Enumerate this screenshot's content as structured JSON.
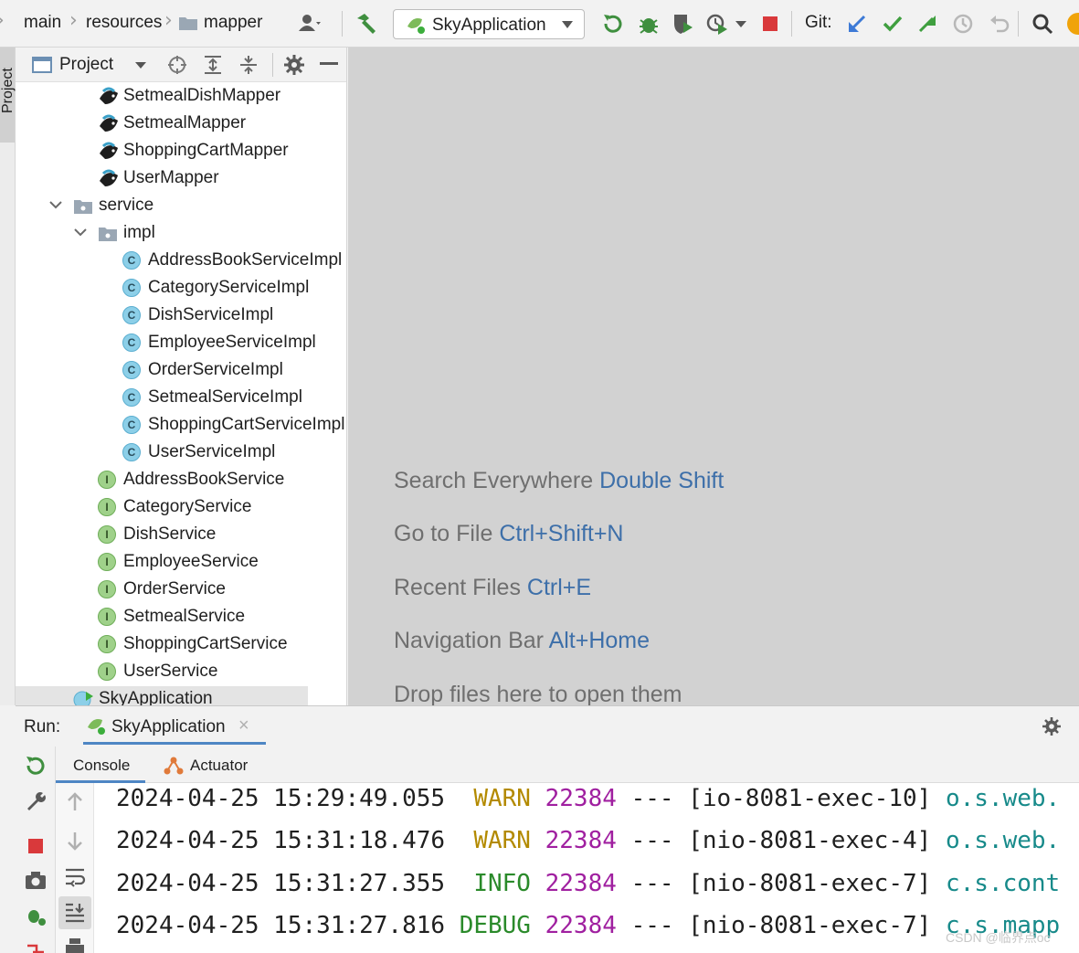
{
  "breadcrumb": {
    "items": [
      "main",
      "resources",
      "mapper"
    ]
  },
  "toolbar": {
    "run_config": "SkyApplication",
    "git_label": "Git:"
  },
  "project_panel": {
    "title": "Project",
    "tree": [
      {
        "label": "SetmealDishMapper",
        "kind": "mapper",
        "indent": 2
      },
      {
        "label": "SetmealMapper",
        "kind": "mapper",
        "indent": 2
      },
      {
        "label": "ShoppingCartMapper",
        "kind": "mapper",
        "indent": 2
      },
      {
        "label": "UserMapper",
        "kind": "mapper",
        "indent": 2
      },
      {
        "label": "service",
        "kind": "folder",
        "indent": 1,
        "expanded": true
      },
      {
        "label": "impl",
        "kind": "folder",
        "indent": 2,
        "expanded": true
      },
      {
        "label": "AddressBookServiceImpl",
        "kind": "class",
        "indent": 3
      },
      {
        "label": "CategoryServiceImpl",
        "kind": "class",
        "indent": 3
      },
      {
        "label": "DishServiceImpl",
        "kind": "class",
        "indent": 3
      },
      {
        "label": "EmployeeServiceImpl",
        "kind": "class",
        "indent": 3
      },
      {
        "label": "OrderServiceImpl",
        "kind": "class",
        "indent": 3
      },
      {
        "label": "SetmealServiceImpl",
        "kind": "class",
        "indent": 3
      },
      {
        "label": "ShoppingCartServiceImpl",
        "kind": "class",
        "indent": 3
      },
      {
        "label": "UserServiceImpl",
        "kind": "class",
        "indent": 3
      },
      {
        "label": "AddressBookService",
        "kind": "interface",
        "indent": 2
      },
      {
        "label": "CategoryService",
        "kind": "interface",
        "indent": 2
      },
      {
        "label": "DishService",
        "kind": "interface",
        "indent": 2
      },
      {
        "label": "EmployeeService",
        "kind": "interface",
        "indent": 2
      },
      {
        "label": "OrderService",
        "kind": "interface",
        "indent": 2
      },
      {
        "label": "SetmealService",
        "kind": "interface",
        "indent": 2
      },
      {
        "label": "ShoppingCartService",
        "kind": "interface",
        "indent": 2
      },
      {
        "label": "UserService",
        "kind": "interface",
        "indent": 2
      },
      {
        "label": "SkyApplication",
        "kind": "app",
        "indent": 1
      }
    ]
  },
  "editor": {
    "hints": [
      {
        "text": "Search Everywhere",
        "key": "Double Shift"
      },
      {
        "text": "Go to File",
        "key": "Ctrl+Shift+N"
      },
      {
        "text": "Recent Files",
        "key": "Ctrl+E"
      },
      {
        "text": "Navigation Bar",
        "key": "Alt+Home"
      },
      {
        "text": "Drop files here to open them",
        "key": ""
      }
    ]
  },
  "run_panel": {
    "label": "Run:",
    "tab": "SkyApplication",
    "sub_tabs": [
      "Console",
      "Actuator"
    ],
    "log": [
      {
        "timestamp": "2024-04-25 15:29:49.055",
        "level": " WARN",
        "pid": "22384",
        "sep": "---",
        "thread": "[io-8081-exec-10]",
        "logger": "o.s.web."
      },
      {
        "timestamp": "2024-04-25 15:31:18.476",
        "level": " WARN",
        "pid": "22384",
        "sep": "---",
        "thread": "[nio-8081-exec-4]",
        "logger": "o.s.web."
      },
      {
        "timestamp": "2024-04-25 15:31:27.355",
        "level": " INFO",
        "pid": "22384",
        "sep": "---",
        "thread": "[nio-8081-exec-7]",
        "logger": "c.s.cont"
      },
      {
        "timestamp": "2024-04-25 15:31:27.816",
        "level": "DEBUG",
        "pid": "22384",
        "sep": "---",
        "thread": "[nio-8081-exec-7]",
        "logger": "c.s.mapp"
      }
    ]
  },
  "watermark": "CSDN @临界点oc",
  "colors": {
    "accent": "#4e86c4",
    "editor_bg": "#d2d2d2",
    "hint_key": "#3d6fa9",
    "warn": "#b38a00",
    "info": "#2a8a2a",
    "pid": "#a020a0",
    "logger": "#178a8a"
  }
}
